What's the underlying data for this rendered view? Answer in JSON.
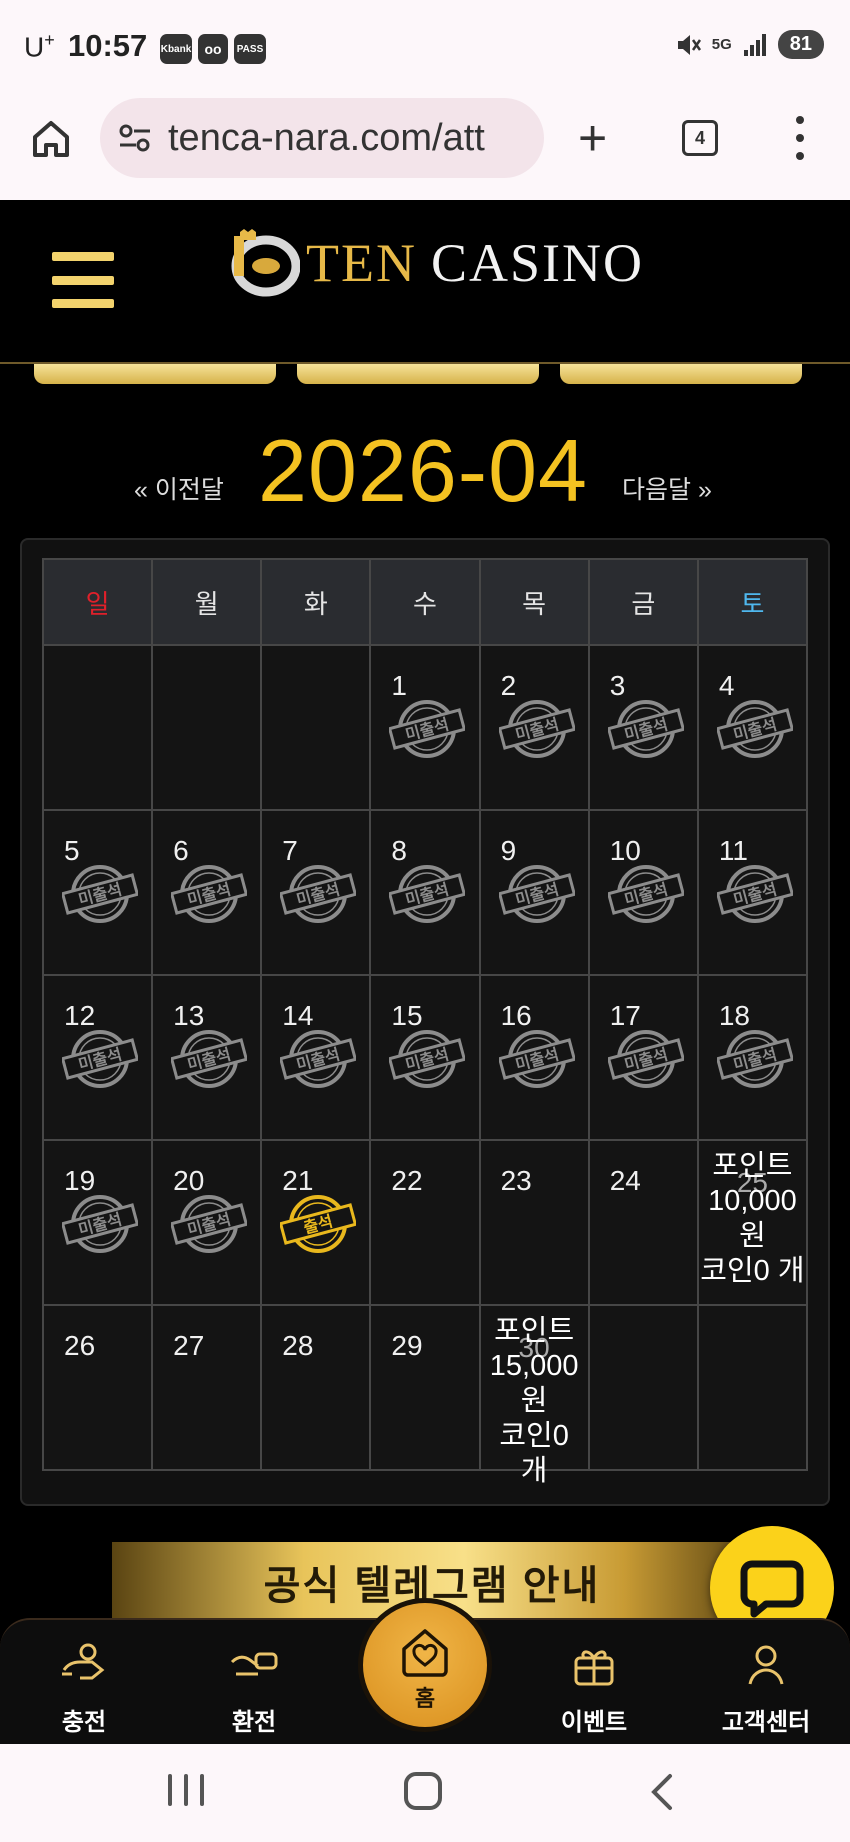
{
  "status_bar": {
    "carrier": "U",
    "carrier_sup": "+",
    "time": "10:57",
    "chips": [
      "Kbank",
      "oo",
      "PASS"
    ],
    "network": "5G",
    "battery": "81"
  },
  "browser": {
    "url": "tenca-nara.com/att",
    "tab_count": "4"
  },
  "site": {
    "logo_ten": "TEN",
    "logo_casino": "CASINO"
  },
  "calendar": {
    "prev_label": "« 이전달",
    "month": "2026-04",
    "next_label": "다음달 »",
    "weekdays": [
      "일",
      "월",
      "화",
      "수",
      "목",
      "금",
      "토"
    ],
    "weekday_colors": {
      "sun": "#e0202a",
      "sat": "#4fb8ee",
      "default": "#e5e5e5"
    },
    "stamp_absent": "미출석",
    "stamp_present": "출석",
    "weeks": [
      [
        {
          "day": ""
        },
        {
          "day": ""
        },
        {
          "day": ""
        },
        {
          "day": "1",
          "stamp": "absent"
        },
        {
          "day": "2",
          "stamp": "absent"
        },
        {
          "day": "3",
          "stamp": "absent"
        },
        {
          "day": "4",
          "stamp": "absent"
        }
      ],
      [
        {
          "day": "5",
          "stamp": "absent"
        },
        {
          "day": "6",
          "stamp": "absent"
        },
        {
          "day": "7",
          "stamp": "absent"
        },
        {
          "day": "8",
          "stamp": "absent"
        },
        {
          "day": "9",
          "stamp": "absent"
        },
        {
          "day": "10",
          "stamp": "absent"
        },
        {
          "day": "11",
          "stamp": "absent"
        }
      ],
      [
        {
          "day": "12",
          "stamp": "absent"
        },
        {
          "day": "13",
          "stamp": "absent"
        },
        {
          "day": "14",
          "stamp": "absent"
        },
        {
          "day": "15",
          "stamp": "absent"
        },
        {
          "day": "16",
          "stamp": "absent"
        },
        {
          "day": "17",
          "stamp": "absent"
        },
        {
          "day": "18",
          "stamp": "absent"
        }
      ],
      [
        {
          "day": "19",
          "stamp": "absent"
        },
        {
          "day": "20",
          "stamp": "absent"
        },
        {
          "day": "21",
          "stamp": "present"
        },
        {
          "day": "22"
        },
        {
          "day": "23"
        },
        {
          "day": "24"
        },
        {
          "day": "25",
          "reward": [
            "포인트",
            "10,000",
            "원",
            "코인0 개"
          ]
        }
      ],
      [
        {
          "day": "26"
        },
        {
          "day": "27"
        },
        {
          "day": "28"
        },
        {
          "day": "29"
        },
        {
          "day": "30",
          "reward": [
            "포인트",
            "15,000",
            "원",
            "코인0",
            "개"
          ]
        },
        {
          "day": ""
        },
        {
          "day": ""
        }
      ]
    ]
  },
  "banner": {
    "text": "공식 텔레그램 안내"
  },
  "bottom_nav": {
    "charge": "충전",
    "exchange": "환전",
    "home": "홈",
    "event": "이벤트",
    "support": "고객센터"
  }
}
